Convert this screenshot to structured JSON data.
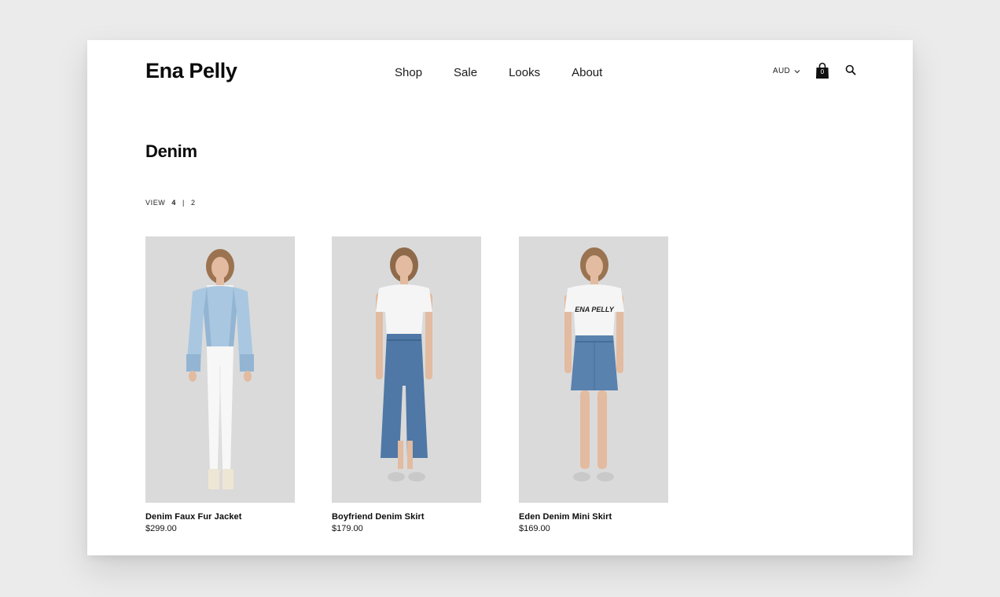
{
  "brand": {
    "name": "Ena Pelly"
  },
  "nav": {
    "items": [
      "Shop",
      "Sale",
      "Looks",
      "About"
    ]
  },
  "header": {
    "currency": "AUD",
    "cart_count": "0",
    "icons": {
      "cart": "shopping-bag-icon",
      "search": "search-icon",
      "currency": "chevron-down-icon"
    }
  },
  "page": {
    "title": "Denim"
  },
  "view": {
    "label": "VIEW",
    "options": [
      "4",
      "2"
    ],
    "active": "4",
    "separator": "|"
  },
  "products": [
    {
      "name": "Denim Faux Fur Jacket",
      "price": "$299.00",
      "print": ""
    },
    {
      "name": "Boyfriend Denim Skirt",
      "price": "$179.00",
      "print": ""
    },
    {
      "name": "Eden Denim Mini Skirt",
      "price": "$169.00",
      "print": "ENA PELLY"
    }
  ],
  "colors": {
    "page_bg": "#ebebeb",
    "window_bg": "#ffffff",
    "text": "#0b0b0b",
    "photo_bg": "#dcdcdc",
    "denim_light": "#a9c7e0",
    "denim_mid": "#4f78a6"
  }
}
